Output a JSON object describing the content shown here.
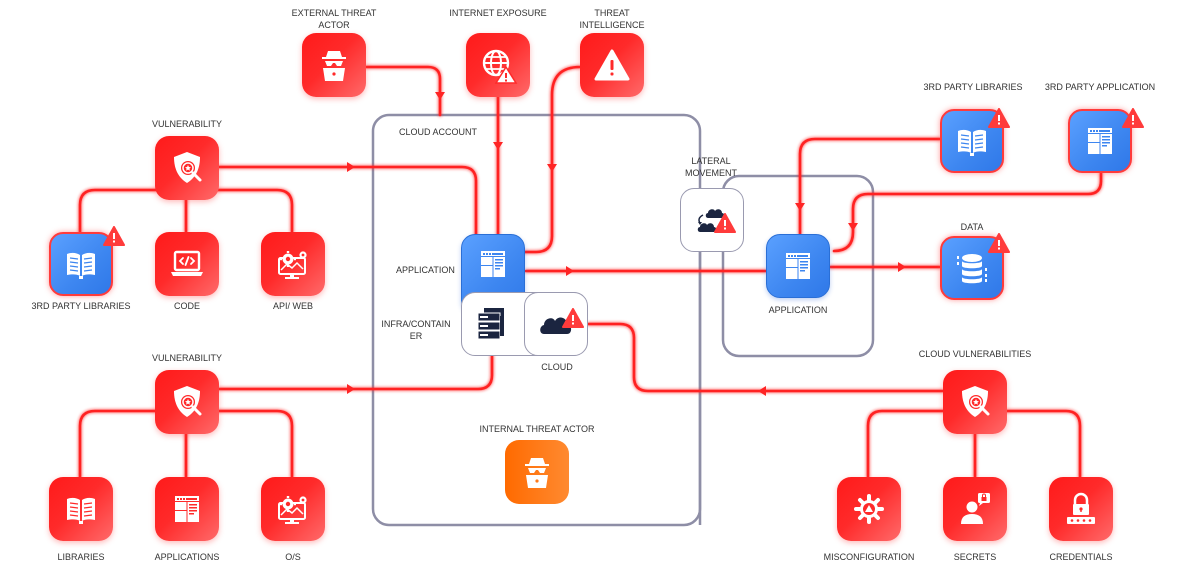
{
  "colors": {
    "threat_red": "#ff2020",
    "asset_blue": "#3d86f0",
    "internal_orange": "#ff7a1a",
    "container_border": "#8e8ea6",
    "connector": "#ff2a2a",
    "label_text": "#333333"
  },
  "external": {
    "external_threat_actor": {
      "label_line1": "EXTERNAL THREAT",
      "label_line2": "ACTOR",
      "icon": "hacker-icon"
    },
    "internet_exposure": {
      "label": "INTERNET EXPOSURE",
      "icon": "globe-warning-icon"
    },
    "threat_intelligence": {
      "label_line1": "THREAT",
      "label_line2": "INTELLIGENCE",
      "icon": "warning-triangle-icon"
    }
  },
  "vulnerability_top": {
    "label": "VULNERABILITY",
    "icon": "shield-search-icon",
    "children": [
      {
        "label": "3RD PARTY LIBRARIES",
        "icon": "book-icon",
        "style": "blue-warning"
      },
      {
        "label": "CODE",
        "icon": "code-laptop-icon",
        "style": "red"
      },
      {
        "label": "API/ WEB",
        "icon": "gears-monitor-icon",
        "style": "red"
      }
    ]
  },
  "vulnerability_bottom": {
    "label": "VULNERABILITY",
    "icon": "shield-search-icon",
    "children": [
      {
        "label": "LIBRARIES",
        "icon": "book-icon",
        "style": "red"
      },
      {
        "label": "APPLICATIONS",
        "icon": "app-window-icon",
        "style": "red"
      },
      {
        "label": "O/S",
        "icon": "gears-monitor-icon",
        "style": "red"
      }
    ]
  },
  "cloud_account": {
    "label": "CLOUD ACCOUNT",
    "application_label": "APPLICATION",
    "infra_label_line1": "INFRA/CONTAIN",
    "infra_label_line2": "ER",
    "cloud_label": "CLOUD",
    "internal_threat_label": "INTERNAL THREAT ACTOR"
  },
  "lateral_movement": {
    "label_line1": "LATERAL",
    "label_line2": "MOVEMENT",
    "icon": "clouds-transfer-icon"
  },
  "remote_app": {
    "label": "APPLICATION"
  },
  "right_assets": {
    "third_party_libraries": {
      "label": "3RD PARTY LIBRARIES",
      "icon": "book-icon"
    },
    "third_party_application": {
      "label": "3RD PARTY APPLICATION",
      "icon": "app-window-icon"
    },
    "data": {
      "label": "DATA",
      "icon": "database-icon"
    }
  },
  "cloud_vulnerabilities": {
    "label": "CLOUD VULNERABILITIES",
    "icon": "shield-search-icon",
    "children": [
      {
        "label": "MISCONFIGURATION",
        "icon": "gear-warning-icon"
      },
      {
        "label": "SECRETS",
        "icon": "user-lock-icon"
      },
      {
        "label": "CREDENTIALS",
        "icon": "padlock-password-icon"
      }
    ]
  }
}
